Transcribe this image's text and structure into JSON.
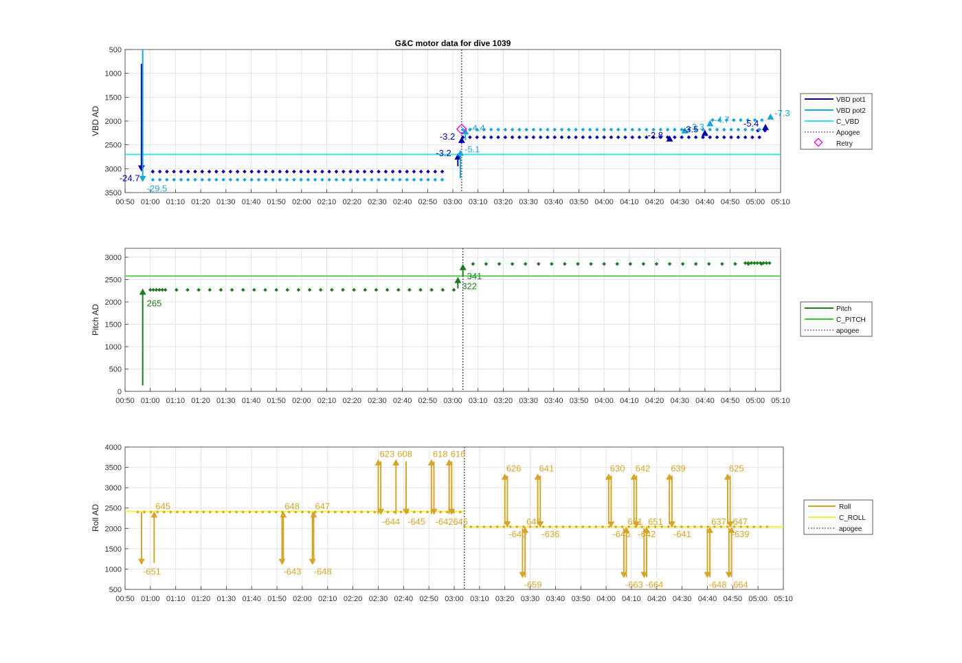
{
  "figure": {
    "title": "G&C motor data for dive 1039",
    "time_ticks": [
      "00:50",
      "01:00",
      "01:10",
      "01:20",
      "01:30",
      "01:40",
      "01:50",
      "02:00",
      "02:10",
      "02:20",
      "02:30",
      "02:40",
      "02:50",
      "03:00",
      "03:10",
      "03:20",
      "03:30",
      "03:40",
      "03:50",
      "04:00",
      "04:10",
      "04:20",
      "04:30",
      "04:40",
      "04:50",
      "05:00",
      "05:10"
    ]
  },
  "colors": {
    "vbd_pot1": "#0000a8",
    "vbd_pot2": "#1aa6d9",
    "c_vbd": "#33e0e6",
    "apogee": "#555555",
    "retry": "#e600e6",
    "pitch": "#1e7b1e",
    "c_pitch": "#33cc33",
    "roll": "#d4a52a",
    "c_roll": "#f2f23a"
  },
  "chart_data": [
    {
      "type": "line",
      "name": "vbd",
      "ylabel": "VBD AD",
      "xlim": [
        50,
        310
      ],
      "ylim": [
        3500,
        500
      ],
      "y_reversed": true,
      "yticks": [
        500,
        1000,
        1500,
        2000,
        2500,
        3000,
        3500
      ],
      "grid": true,
      "legend_position": "right",
      "legend": [
        "VBD pot1",
        "VBD pot2",
        "C_VBD",
        "Apogee",
        "Retry"
      ],
      "apogee_x": 183.5,
      "c_vbd": 2700,
      "series": [
        {
          "name": "VBD pot1",
          "x_start": 61,
          "x_end": 304,
          "step": 2.8,
          "segments": [
            [
              61,
              176,
              3060
            ],
            [
              184,
              304,
              2340
            ]
          ],
          "end": [
            [
              301,
              304,
              2200
            ]
          ]
        },
        {
          "name": "VBD pot2",
          "x_start": 61,
          "x_end": 304,
          "step": 2.8,
          "segments": [
            [
              61,
              176,
              3230
            ],
            [
              184,
              304,
              2180
            ]
          ],
          "end": [
            [
              283,
              304,
              1980
            ]
          ]
        }
      ],
      "events": [
        {
          "series": "VBD pot1",
          "x": 56.5,
          "y_from": 800,
          "y_to": 3060,
          "label": "-24.7"
        },
        {
          "series": "VBD pot2",
          "x": 57,
          "y_from": 500,
          "y_to": 3280,
          "label": "-29.5"
        },
        {
          "series": "VBD pot1",
          "x": 182,
          "y_from": 2950,
          "y_to": 2680,
          "label": "-3.2"
        },
        {
          "series": "VBD pot2",
          "x": 183,
          "y_from": 3200,
          "y_to": 2600,
          "label": "-5.1"
        },
        {
          "series": "VBD pot1",
          "x": 183.5,
          "y_from": 2450,
          "y_to": 2330,
          "label": "-3.2"
        },
        {
          "series": "VBD pot2",
          "x": 185,
          "y_from": 2400,
          "y_to": 2150,
          "label": "-4.4"
        },
        {
          "series": "VBD pot1",
          "x": 266,
          "y_from": 2340,
          "y_to": 2300,
          "label": "-2.8"
        },
        {
          "series": "VBD pot2",
          "x": 272,
          "y_from": 2180,
          "y_to": 2130,
          "label": "-3.3"
        },
        {
          "series": "VBD pot1",
          "x": 280,
          "y_from": 2250,
          "y_to": 2180,
          "label": "-3.5"
        },
        {
          "series": "VBD pot2",
          "x": 282,
          "y_from": 2100,
          "y_to": 1980,
          "label": "-4.7"
        },
        {
          "series": "VBD pot1",
          "x": 304,
          "y_from": 2200,
          "y_to": 2060,
          "label": "-5.4"
        },
        {
          "series": "VBD pot2",
          "x": 306,
          "y_from": 1960,
          "y_to": 1840,
          "label": "-7.3"
        }
      ],
      "retry": [
        {
          "x": 183.5,
          "y": 2170
        }
      ]
    },
    {
      "type": "line",
      "name": "pitch",
      "ylabel": "Pitch AD",
      "xlim": [
        50,
        310
      ],
      "ylim": [
        0,
        3200
      ],
      "yticks": [
        0,
        500,
        1000,
        1500,
        2000,
        2500,
        3000
      ],
      "grid": true,
      "legend_position": "right",
      "legend": [
        "Pitch",
        "C_PITCH",
        "apogee"
      ],
      "apogee_x": 184,
      "c_pitch": 2580,
      "series": [
        {
          "name": "Pitch",
          "x_start": 60,
          "x_end": 306,
          "segments": [
            [
              60,
              66,
              2270,
              1.2
            ],
            [
              66,
              181,
              2270,
              4.4
            ],
            [
              188,
              306,
              2850,
              5.2
            ]
          ],
          "end": [
            [
              296,
              306,
              2870,
              1.2
            ]
          ]
        }
      ],
      "events": [
        {
          "series": "Pitch",
          "x": 57,
          "y_from": 130,
          "y_to": 2300,
          "label": "265"
        },
        {
          "series": "Pitch",
          "x": 182,
          "y_from": 2300,
          "y_to": 2560,
          "label": "322"
        },
        {
          "series": "Pitch",
          "x": 184,
          "y_from": 2580,
          "y_to": 2850,
          "label": "341"
        }
      ]
    },
    {
      "type": "line",
      "name": "roll",
      "ylabel": "Roll AD",
      "xlim": [
        50,
        310
      ],
      "ylim": [
        500,
        4000
      ],
      "yticks": [
        500,
        1000,
        1500,
        2000,
        2500,
        3000,
        3500,
        4000
      ],
      "grid": true,
      "legend_position": "right",
      "legend": [
        "Roll",
        "C_ROLL",
        "apogee"
      ],
      "apogee_x": 184,
      "c_roll": [
        [
          50,
          184,
          2420
        ],
        [
          184,
          310,
          2040
        ]
      ],
      "series": [
        {
          "name": "Roll",
          "segments": [
            [
              55,
              184,
              2400
            ],
            [
              184,
              306,
              2040
            ]
          ]
        }
      ],
      "events": [
        {
          "x": 56.5,
          "y_from": 2400,
          "y_to": 1100,
          "label": "-651"
        },
        {
          "x": 61.5,
          "y_from": 1150,
          "y_to": 2420,
          "label": "645"
        },
        {
          "x": 112,
          "y_from": 2400,
          "y_to": 1100,
          "label": "-643"
        },
        {
          "x": 112.5,
          "y_from": 1150,
          "y_to": 2420,
          "label": "648"
        },
        {
          "x": 124,
          "y_from": 2400,
          "y_to": 1100,
          "label": "-648"
        },
        {
          "x": 124.5,
          "y_from": 1150,
          "y_to": 2420,
          "label": "647"
        },
        {
          "x": 150,
          "y_from": 2350,
          "y_to": 3700,
          "label": "623"
        },
        {
          "x": 151,
          "y_from": 3650,
          "y_to": 2330,
          "label": "-644"
        },
        {
          "x": 157,
          "y_from": 2350,
          "y_to": 3700,
          "label": "608"
        },
        {
          "x": 161,
          "y_from": 3650,
          "y_to": 2330,
          "label": "-645"
        },
        {
          "x": 171,
          "y_from": 2350,
          "y_to": 3700,
          "label": "618"
        },
        {
          "x": 172,
          "y_from": 3650,
          "y_to": 2330,
          "label": "-642"
        },
        {
          "x": 178,
          "y_from": 2350,
          "y_to": 3700,
          "label": "616"
        },
        {
          "x": 179,
          "y_from": 3650,
          "y_to": 2330,
          "label": "645"
        },
        {
          "x": 200,
          "y_from": 2100,
          "y_to": 3350,
          "label": "626"
        },
        {
          "x": 201,
          "y_from": 3300,
          "y_to": 2020,
          "label": "-640"
        },
        {
          "x": 207,
          "y_from": 2000,
          "y_to": 780,
          "label": "-659"
        },
        {
          "x": 208,
          "y_from": 800,
          "y_to": 2040,
          "label": "648"
        },
        {
          "x": 213,
          "y_from": 2100,
          "y_to": 3350,
          "label": "641"
        },
        {
          "x": 214,
          "y_from": 3300,
          "y_to": 2020,
          "label": "-636"
        },
        {
          "x": 241,
          "y_from": 2100,
          "y_to": 3350,
          "label": "630"
        },
        {
          "x": 242,
          "y_from": 3300,
          "y_to": 2020,
          "label": "-646"
        },
        {
          "x": 247,
          "y_from": 2000,
          "y_to": 780,
          "label": "-663"
        },
        {
          "x": 248,
          "y_from": 800,
          "y_to": 2040,
          "label": "651"
        },
        {
          "x": 251,
          "y_from": 2100,
          "y_to": 3350,
          "label": "642"
        },
        {
          "x": 252,
          "y_from": 3300,
          "y_to": 2020,
          "label": "-642"
        },
        {
          "x": 255,
          "y_from": 2000,
          "y_to": 780,
          "label": "-664"
        },
        {
          "x": 256,
          "y_from": 800,
          "y_to": 2040,
          "label": "651"
        },
        {
          "x": 265,
          "y_from": 2100,
          "y_to": 3350,
          "label": "639"
        },
        {
          "x": 266,
          "y_from": 3300,
          "y_to": 2020,
          "label": "-641"
        },
        {
          "x": 280,
          "y_from": 2000,
          "y_to": 780,
          "label": "-648"
        },
        {
          "x": 281,
          "y_from": 800,
          "y_to": 2040,
          "label": "637"
        },
        {
          "x": 288,
          "y_from": 2100,
          "y_to": 3350,
          "label": "625"
        },
        {
          "x": 289,
          "y_from": 3300,
          "y_to": 2020,
          "label": "-639"
        },
        {
          "x": 288.5,
          "y_from": 2000,
          "y_to": 780,
          "label": "-664"
        },
        {
          "x": 289.5,
          "y_from": 800,
          "y_to": 2040,
          "label": "647"
        }
      ]
    }
  ]
}
